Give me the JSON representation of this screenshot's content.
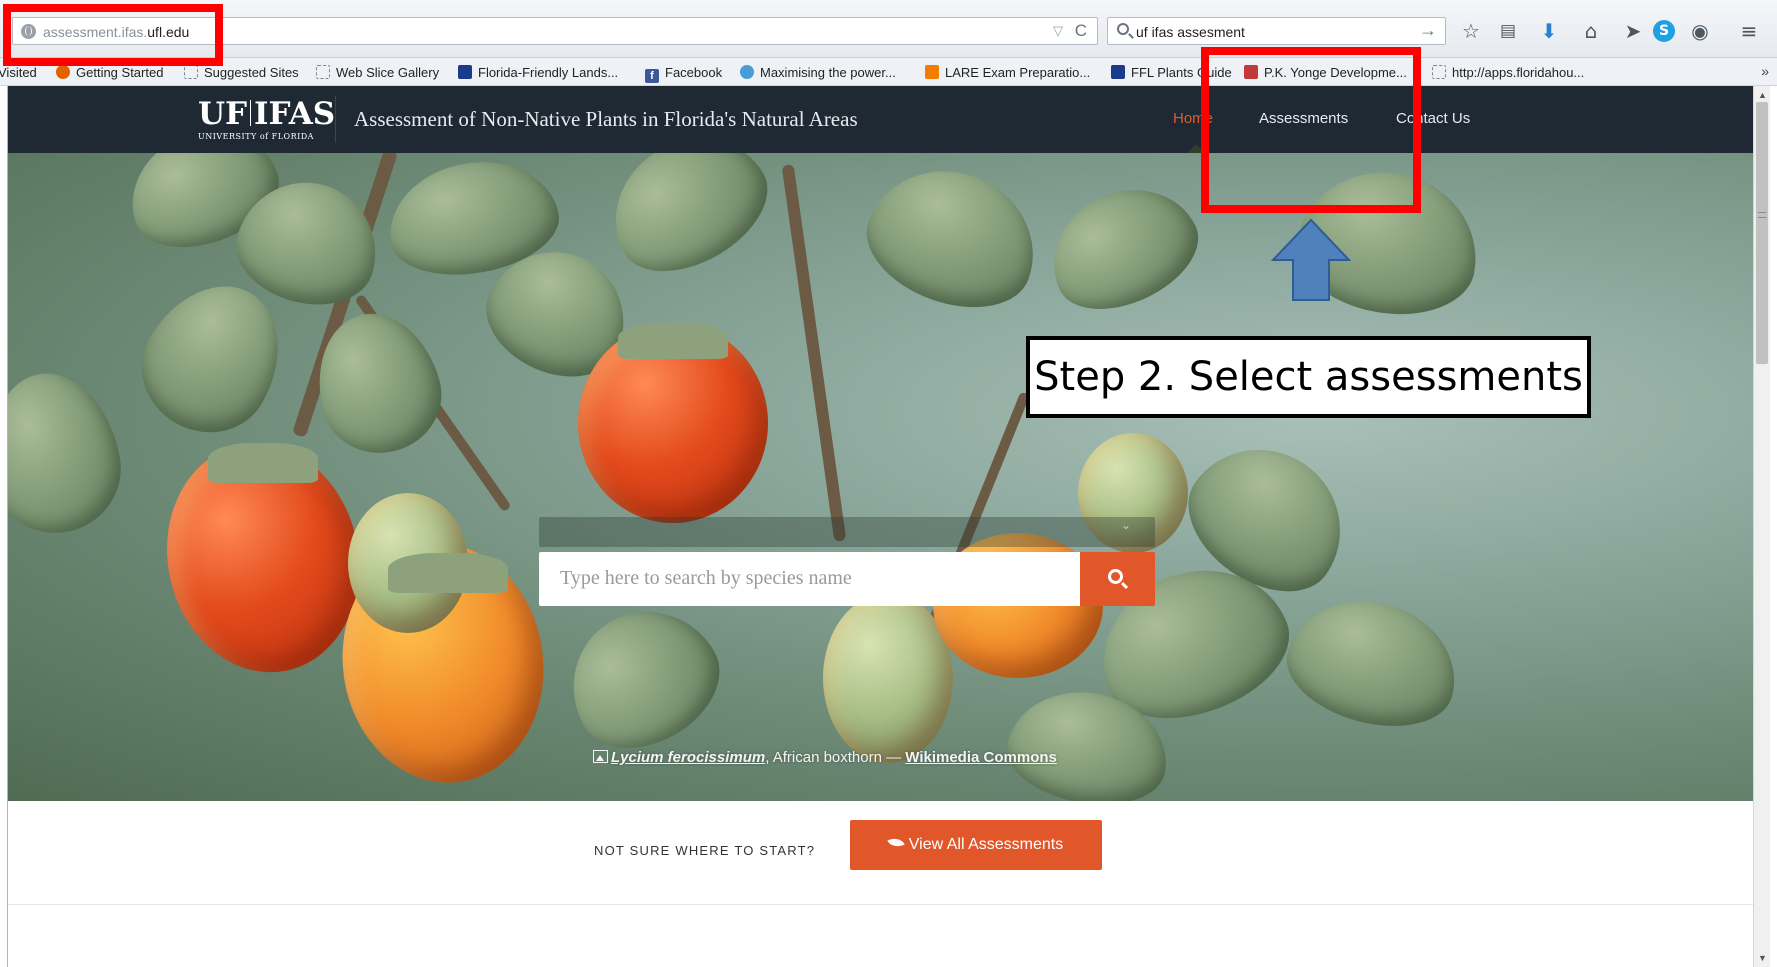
{
  "browser": {
    "url_prefix": "assessment.ifas.",
    "url_domain": "ufl.edu",
    "url_dropdown": "▽",
    "reload": "C",
    "search_query": "uf ifas assesment",
    "search_go": "→",
    "toolbar_icons": [
      "star-icon",
      "reading-list-icon",
      "download-icon",
      "home-icon",
      "send-icon",
      "skype-icon",
      "sync-icon",
      "menu-icon"
    ]
  },
  "bookmarks": {
    "items": [
      {
        "label": "Visited",
        "icon": "none"
      },
      {
        "label": "Getting Started",
        "icon": "firefox-icon"
      },
      {
        "label": "Suggested Sites",
        "icon": "page-icon"
      },
      {
        "label": "Web Slice Gallery",
        "icon": "page-icon"
      },
      {
        "label": "Florida-Friendly Lands...",
        "icon": "ifas-icon"
      },
      {
        "label": "Facebook",
        "icon": "facebook-icon"
      },
      {
        "label": "Maximising the power...",
        "icon": "tree-icon"
      },
      {
        "label": "LARE Exam Preparatio...",
        "icon": "blogger-icon"
      },
      {
        "label": "FFL Plants Guide",
        "icon": "ifas-icon"
      },
      {
        "label": "P.K. Yonge Developme...",
        "icon": "books-icon"
      },
      {
        "label": "http://apps.floridahou...",
        "icon": "page-icon"
      }
    ],
    "more": "»"
  },
  "site": {
    "logo_main_left": "UF",
    "logo_main_right": "IFAS",
    "logo_sub": "UNIVERSITY of FLORIDA",
    "title": "Assessment of Non-Native Plants in Florida's Natural Areas",
    "nav": {
      "home": "Home",
      "assessments": "Assessments",
      "contact": "Contact Us"
    },
    "active_color": "#e05a2b"
  },
  "hero": {
    "search_placeholder": "Type here to search by species name",
    "caption_species": "Lycium ferocissimum",
    "caption_common": ", African boxthorn — ",
    "caption_source": "Wikimedia Commons"
  },
  "cta": {
    "prompt": "NOT SURE WHERE TO START?",
    "button": "View All Assessments"
  },
  "annotation": {
    "step": "Step 2. Select assessments",
    "highlight_color": "#ff0000",
    "arrow_color": "#4f81bd"
  }
}
